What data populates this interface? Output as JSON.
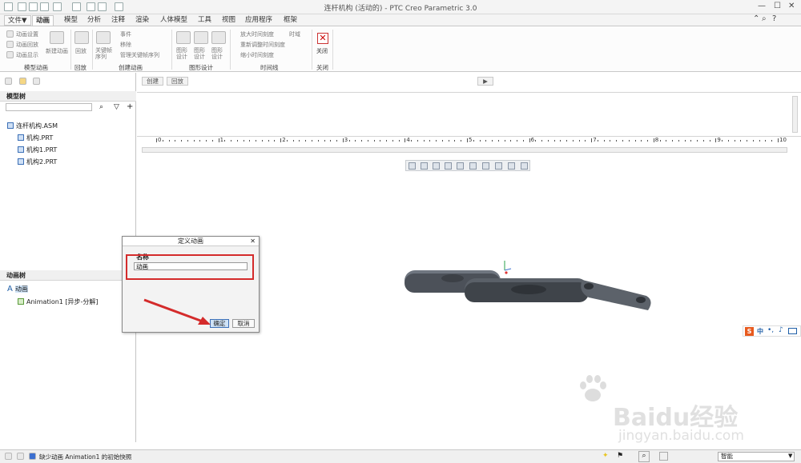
{
  "window": {
    "title": "连杆机构 (活动的) - PTC Creo Parametric 3.0",
    "accent_color": "#1f5fa8"
  },
  "menu_tabs": [
    "文件▼",
    "动画",
    "模型",
    "分析",
    "注释",
    "渲染",
    "人体模型",
    "工具",
    "视图",
    "应用程序",
    "框架"
  ],
  "ribbon": {
    "model_animation": {
      "settings": "动画设置",
      "playback": "动画回放",
      "display": "动画显示",
      "label": "模型动画"
    },
    "new_animation": "新建动画",
    "playback": {
      "button": "回放",
      "label": "回放"
    },
    "keyframe_seq": "关键帧序列",
    "create": {
      "event": "事件",
      "remove": "移除",
      "manage_kfs": "管理关键帧序列",
      "label": "创建动画"
    },
    "graphic_design": {
      "b1": "图形设计",
      "b2": "图形设计",
      "b3": "图形设计",
      "label": "图形设计"
    },
    "timeline": {
      "zoom_in": "放大时间刻度",
      "resize": "重新调整时间刻度",
      "zoom_out": "缩小时间刻度",
      "timeline_toggle": "时域",
      "label": "时间线"
    },
    "close": {
      "button": "关闭",
      "label": "关闭"
    }
  },
  "model_tree": {
    "header": "模型树",
    "items": [
      "连杆机构.ASM",
      "机构.PRT",
      "机构1.PRT",
      "机构2.PRT"
    ]
  },
  "animation_tree": {
    "header": "动画树",
    "root": "动画",
    "child": "Animation1 [异步-分解]"
  },
  "timeline_buttons": {
    "create": "创建",
    "playback": "回放"
  },
  "ruler_ticks": [
    "0",
    "1",
    "2",
    "3",
    "4",
    "5",
    "6",
    "7",
    "8",
    "9",
    "10"
  ],
  "dialog": {
    "title": "定义动画",
    "name_label": "名称",
    "name_value": "动画",
    "ok": "确定",
    "cancel": "取消"
  },
  "status": {
    "message": "缺少动画 Animation1 的初始快照",
    "filter": "智能"
  },
  "ime": {
    "label": "中"
  },
  "watermark": {
    "brand": "Baidu经验",
    "url": "jingyan.baidu.com"
  }
}
